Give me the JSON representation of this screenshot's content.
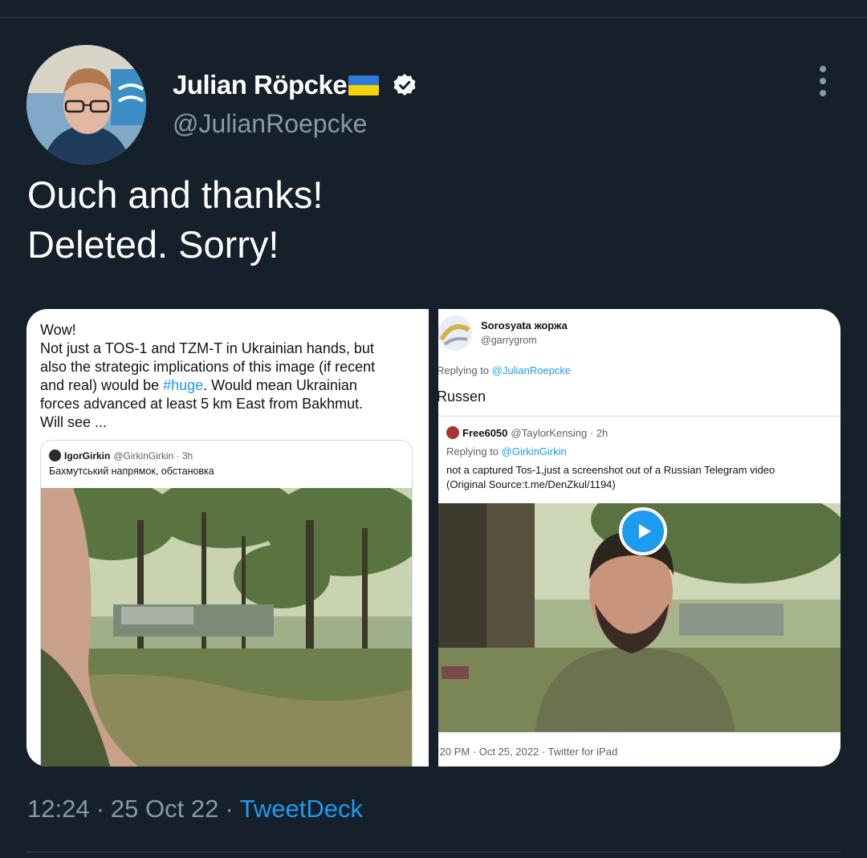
{
  "author": {
    "display_name": "Julian Röpcke",
    "handle": "@JulianRoepcke",
    "verified": true,
    "flag": "ukraine-flag-emoji"
  },
  "tweet": {
    "lines": [
      "Ouch and thanks!",
      "Deleted. Sorry!"
    ]
  },
  "media_left": {
    "text_lines": [
      "Wow!",
      "Not just a TOS-1 and TZM-T in Ukrainian hands, but",
      "also the strategic implications of this image (if recent",
      "and real) would be ",
      ". Would mean Ukrainian",
      "forces advanced at least 5 km East from Bakhmut.",
      "Will see ..."
    ],
    "hashtag": "#huge",
    "quote": {
      "name": "IgorGirkin",
      "handle": "@GirkinGirkin",
      "time": "· 3h",
      "text": "Бахмутський напрямок, обстановка"
    }
  },
  "media_right": {
    "name": "Sorosyata жоржа",
    "handle": "@garrygrom",
    "replying_prefix": "Replying to ",
    "replying_to": "@JulianRoepcke",
    "body": "Russen",
    "card": {
      "name": "Free6050",
      "handle": "@TaylorKensing",
      "time": "· 2h",
      "replying_prefix": "Replying to ",
      "replying_to": "@GirkinGirkin",
      "text_line1": "not a captured Tos-1,just a screenshot out of a Russian Telegram video",
      "text_line2": "(Original Source:t.me/DenZkul/1194)"
    },
    "footer": ":20 PM · Oct 25, 2022 · Twitter for iPad"
  },
  "meta": {
    "time": "12:24",
    "date": "25 Oct 22",
    "separator": "·",
    "source": "TweetDeck"
  },
  "colors": {
    "background": "#15202b",
    "secondary_text": "#8b98a5",
    "accent": "#1d9bf0"
  }
}
